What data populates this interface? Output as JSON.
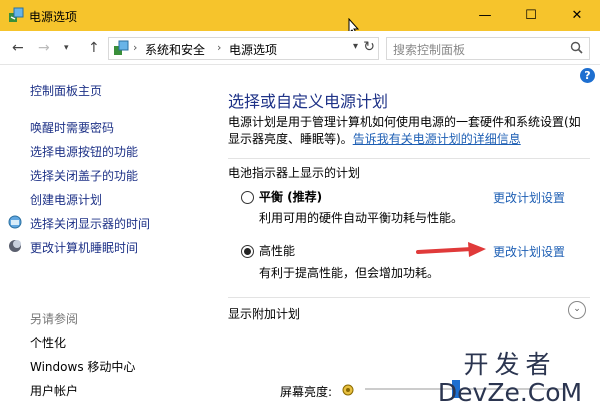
{
  "window": {
    "title": "电源选项"
  },
  "address": {
    "crumbs": [
      "系统和安全",
      "电源选项"
    ],
    "search_placeholder": "搜索控制面板"
  },
  "sidebar": {
    "home": "控制面板主页",
    "links": [
      "唤醒时需要密码",
      "选择电源按钮的功能",
      "选择关闭盖子的功能",
      "创建电源计划",
      "选择关闭显示器的时间",
      "更改计算机睡眠时间"
    ],
    "see_also": "另请参阅",
    "see_also_items": [
      "个性化",
      "Windows 移动中心",
      "用户帐户"
    ]
  },
  "main": {
    "heading": "选择或自定义电源计划",
    "description": "电源计划是用于管理计算机如何使用电源的一套硬件和系统设置(如显示器亮度、睡眠等)。",
    "description_link": "告诉我有关电源计划的详细信息",
    "group_title": "电池指示器上显示的计划",
    "plans": [
      {
        "name": "平衡 (推荐)",
        "desc": "利用可用的硬件自动平衡功耗与性能。",
        "link": "更改计划设置",
        "selected": false
      },
      {
        "name": "高性能",
        "desc": "有利于提高性能，但会增加功耗。",
        "link": "更改计划设置",
        "selected": true
      }
    ],
    "extra_plans": "显示附加计划",
    "brightness_label": "屏幕亮度:"
  },
  "watermark": {
    "line1": "开发者",
    "line2": "DevZe.CoM"
  },
  "icons": [
    "app-icon",
    "back-icon",
    "forward-icon",
    "up-icon",
    "refresh-icon",
    "search-icon",
    "help-icon",
    "shield-icon",
    "moon-icon",
    "expand-icon",
    "sun-icon",
    "arrow-icon"
  ],
  "colors": {
    "titlebar": "#f6c42c",
    "link": "#1e5fb4",
    "heading": "#1e3287",
    "arrow": "#e03a3a"
  }
}
